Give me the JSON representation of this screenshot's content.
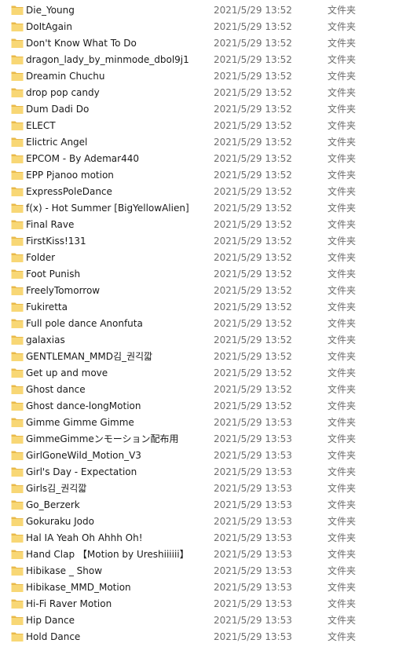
{
  "colors": {
    "folder_body": "#f8d775",
    "folder_tab": "#e9b949",
    "date_text": "#6d6d6d"
  },
  "icon": "folder-icon",
  "files": [
    {
      "name": "Die_Young",
      "date": "2021/5/29 13:52",
      "type": "文件夹"
    },
    {
      "name": "DoItAgain",
      "date": "2021/5/29 13:52",
      "type": "文件夹"
    },
    {
      "name": "Don't Know What To Do",
      "date": "2021/5/29 13:52",
      "type": "文件夹"
    },
    {
      "name": "dragon_lady_by_minmode_dbol9j1",
      "date": "2021/5/29 13:52",
      "type": "文件夹"
    },
    {
      "name": "Dreamin Chuchu",
      "date": "2021/5/29 13:52",
      "type": "文件夹"
    },
    {
      "name": "drop pop candy",
      "date": "2021/5/29 13:52",
      "type": "文件夹"
    },
    {
      "name": "Dum Dadi Do",
      "date": "2021/5/29 13:52",
      "type": "文件夹"
    },
    {
      "name": "ELECT",
      "date": "2021/5/29 13:52",
      "type": "文件夹"
    },
    {
      "name": "Elictric Angel",
      "date": "2021/5/29 13:52",
      "type": "文件夹"
    },
    {
      "name": "EPCOM - By Ademar440",
      "date": "2021/5/29 13:52",
      "type": "文件夹"
    },
    {
      "name": "EPP Pjanoo motion",
      "date": "2021/5/29 13:52",
      "type": "文件夹"
    },
    {
      "name": "ExpressPoleDance",
      "date": "2021/5/29 13:52",
      "type": "文件夹"
    },
    {
      "name": "f(x) - Hot Summer [BigYellowAlien]",
      "date": "2021/5/29 13:52",
      "type": "文件夹"
    },
    {
      "name": "Final Rave",
      "date": "2021/5/29 13:52",
      "type": "文件夹"
    },
    {
      "name": "FirstKiss!131",
      "date": "2021/5/29 13:52",
      "type": "文件夹"
    },
    {
      "name": "Folder",
      "date": "2021/5/29 13:52",
      "type": "文件夹"
    },
    {
      "name": "Foot Punish",
      "date": "2021/5/29 13:52",
      "type": "文件夹"
    },
    {
      "name": "FreelyTomorrow",
      "date": "2021/5/29 13:52",
      "type": "文件夹"
    },
    {
      "name": "Fukiretta",
      "date": "2021/5/29 13:52",
      "type": "文件夹"
    },
    {
      "name": "Full pole dance  Anonfuta",
      "date": "2021/5/29 13:52",
      "type": "文件夹"
    },
    {
      "name": "galaxias",
      "date": "2021/5/29 13:52",
      "type": "文件夹"
    },
    {
      "name": "GENTLEMAN_MMD김_권긱깗",
      "date": "2021/5/29 13:52",
      "type": "文件夹"
    },
    {
      "name": "Get up and move",
      "date": "2021/5/29 13:52",
      "type": "文件夹"
    },
    {
      "name": "Ghost dance",
      "date": "2021/5/29 13:52",
      "type": "文件夹"
    },
    {
      "name": "Ghost dance-longMotion",
      "date": "2021/5/29 13:52",
      "type": "文件夹"
    },
    {
      "name": "Gimme Gimme Gimme",
      "date": "2021/5/29 13:53",
      "type": "文件夹"
    },
    {
      "name": "GimmeGimmeンモーション配布用",
      "date": "2021/5/29 13:53",
      "type": "文件夹"
    },
    {
      "name": "GirlGoneWild_Motion_V3",
      "date": "2021/5/29 13:53",
      "type": "文件夹"
    },
    {
      "name": "Girl's Day - Expectation",
      "date": "2021/5/29 13:53",
      "type": "文件夹"
    },
    {
      "name": "Girls김_권긱깗",
      "date": "2021/5/29 13:53",
      "type": "文件夹"
    },
    {
      "name": "Go_Berzerk",
      "date": "2021/5/29 13:53",
      "type": "文件夹"
    },
    {
      "name": "Gokuraku Jodo",
      "date": "2021/5/29 13:53",
      "type": "文件夹"
    },
    {
      "name": "Hal IA Yeah Oh Ahhh Oh!",
      "date": "2021/5/29 13:53",
      "type": "文件夹"
    },
    {
      "name": "Hand Clap 【Motion by Ureshiiiiii】",
      "date": "2021/5/29 13:53",
      "type": "文件夹"
    },
    {
      "name": "Hibikase _ Show",
      "date": "2021/5/29 13:53",
      "type": "文件夹"
    },
    {
      "name": "Hibikase_MMD_Motion",
      "date": "2021/5/29 13:53",
      "type": "文件夹"
    },
    {
      "name": "Hi-Fi Raver Motion",
      "date": "2021/5/29 13:53",
      "type": "文件夹"
    },
    {
      "name": "Hip Dance",
      "date": "2021/5/29 13:53",
      "type": "文件夹"
    },
    {
      "name": "Hold Dance",
      "date": "2021/5/29 13:53",
      "type": "文件夹"
    }
  ]
}
